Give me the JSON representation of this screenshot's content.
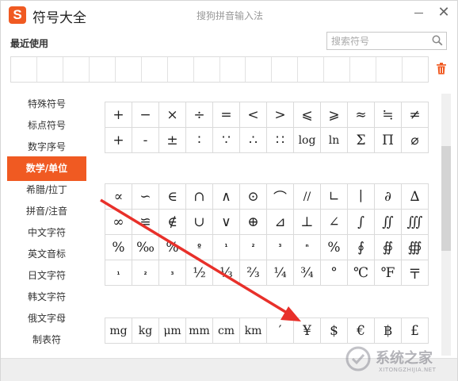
{
  "titlebar": {
    "logo_letter": "S",
    "app_title": "符号大全",
    "ime_name": "搜狗拼音输入法",
    "close_glyph": "✕"
  },
  "recent": {
    "label": "最近使用",
    "slots": 16
  },
  "search": {
    "placeholder": "搜索符号"
  },
  "sidebar": {
    "items": [
      {
        "label": "特殊符号"
      },
      {
        "label": "标点符号"
      },
      {
        "label": "数字序号"
      },
      {
        "label": "数学/单位",
        "active": true
      },
      {
        "label": "希腊/拉丁"
      },
      {
        "label": "拼音/注音"
      },
      {
        "label": "中文字符"
      },
      {
        "label": "英文音标"
      },
      {
        "label": "日文字符"
      },
      {
        "label": "韩文字符"
      },
      {
        "label": "俄文字母"
      },
      {
        "label": "制表符"
      }
    ],
    "active_color": "#f05a22"
  },
  "symbols": {
    "group1": [
      [
        "+",
        "−",
        "×",
        "÷",
        "=",
        "<",
        ">",
        "⩽",
        "⩾",
        "≈",
        "≒",
        "≠"
      ],
      [
        "+",
        "-",
        "±",
        "∶",
        "∵",
        "∴",
        "∷",
        "log",
        "ln",
        "Σ",
        "Π",
        "⌀"
      ]
    ],
    "group2": [
      [
        "∝",
        "∽",
        "∈",
        "∩",
        "∧",
        "⊙",
        "⌒",
        "//",
        "∟",
        "∣",
        "∂",
        "∆"
      ],
      [
        "∞",
        "≌",
        "∉",
        "∪",
        "∨",
        "⊕",
        "⊿",
        "⊥",
        "∠",
        "∫",
        "∬",
        "∭"
      ],
      [
        "%",
        "‰",
        "%",
        "º",
        "¹",
        "²",
        "³",
        "ⁿ",
        "%",
        "∮",
        "∯",
        "∰"
      ],
      [
        "₁",
        "₂",
        "₃",
        "½",
        "⅓",
        "⅔",
        "¼",
        "¾",
        "°",
        "℃",
        "℉",
        "〒"
      ]
    ],
    "group3": [
      [
        "mg",
        "kg",
        "μm",
        "mm",
        "cm",
        "km",
        "′",
        "¥",
        "$",
        "€",
        "฿",
        "£"
      ]
    ]
  },
  "watermark": {
    "text": "系统之家",
    "sub": "XITONGZHIJIA.NET"
  },
  "colors": {
    "accent": "#f05a22",
    "annotation_arrow": "#e8302a"
  }
}
